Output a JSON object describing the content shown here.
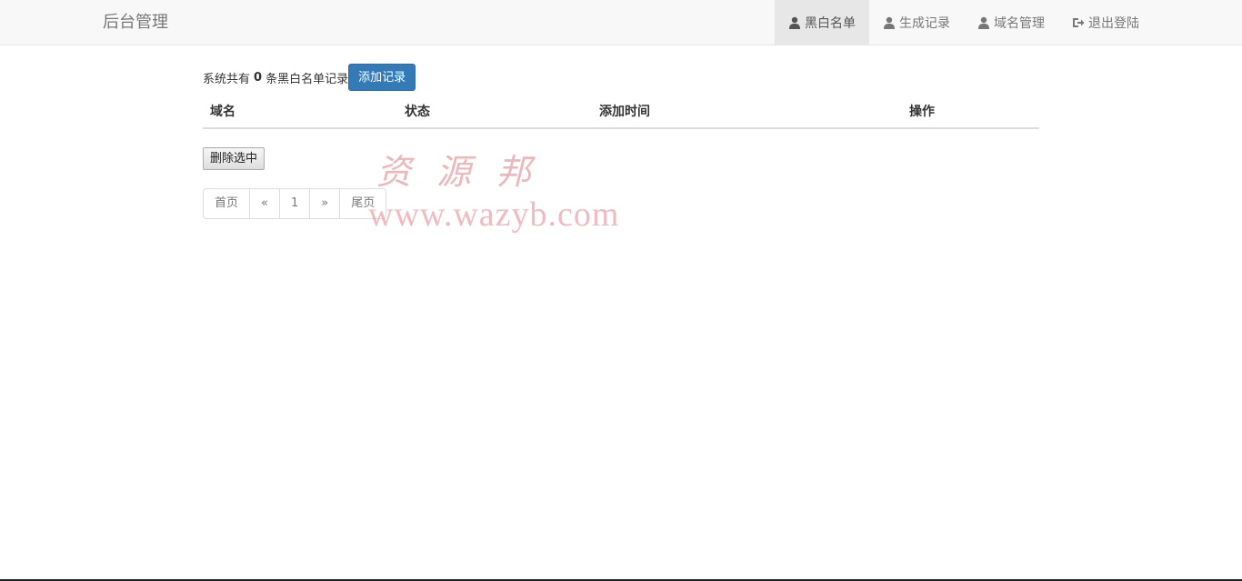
{
  "header": {
    "brand": "后台管理",
    "nav": [
      {
        "label": "黑白名单",
        "icon": "user-icon",
        "active": true
      },
      {
        "label": "生成记录",
        "icon": "user-icon",
        "active": false
      },
      {
        "label": "域名管理",
        "icon": "user-icon",
        "active": false
      },
      {
        "label": "退出登陆",
        "icon": "logout-icon",
        "active": false
      }
    ]
  },
  "summary": {
    "prefix": "系统共有",
    "count": "0",
    "suffix": "条黑白名单记录",
    "add_button": "添加记录"
  },
  "table": {
    "columns": [
      "域名",
      "状态",
      "添加时间",
      "操作"
    ],
    "rows": []
  },
  "actions": {
    "delete_selected": "删除选中"
  },
  "pagination": {
    "first": "首页",
    "prev": "«",
    "current": "1",
    "next": "»",
    "last": "尾页"
  },
  "watermark": {
    "chinese": "资源邦",
    "url": "www.wazyb.com"
  },
  "colors": {
    "primary": "#337ab7",
    "navbar_bg": "#f8f8f8",
    "nav_active_bg": "#e7e7e7",
    "watermark": "#e07882"
  }
}
